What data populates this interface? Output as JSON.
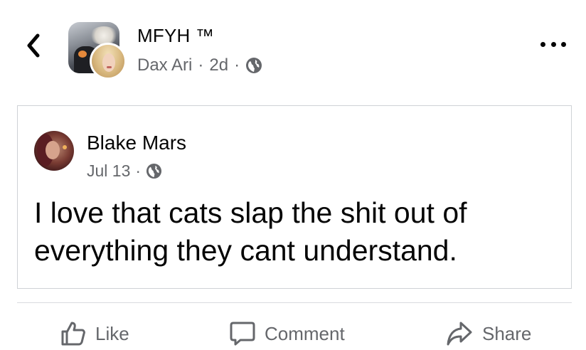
{
  "header": {
    "group_name": "MFYH ™",
    "author": "Dax Ari",
    "separator": "·",
    "time": "2d",
    "audience_icon": "globe-icon",
    "back_icon": "chevron-left-icon",
    "more_icon": "more-horizontal-icon"
  },
  "shared_post": {
    "author": "Blake Mars",
    "date": "Jul 13",
    "separator": "·",
    "audience_icon": "globe-icon",
    "text": "I love that cats slap the shit out of everything they cant understand."
  },
  "actions": {
    "like_label": "Like",
    "comment_label": "Comment",
    "share_label": "Share",
    "like_icon": "thumbs-up-icon",
    "comment_icon": "speech-bubble-icon",
    "share_icon": "share-arrow-icon"
  },
  "colors": {
    "text_primary": "#050505",
    "text_secondary": "#65676b",
    "border": "#cfd2d6",
    "background": "#ffffff"
  }
}
